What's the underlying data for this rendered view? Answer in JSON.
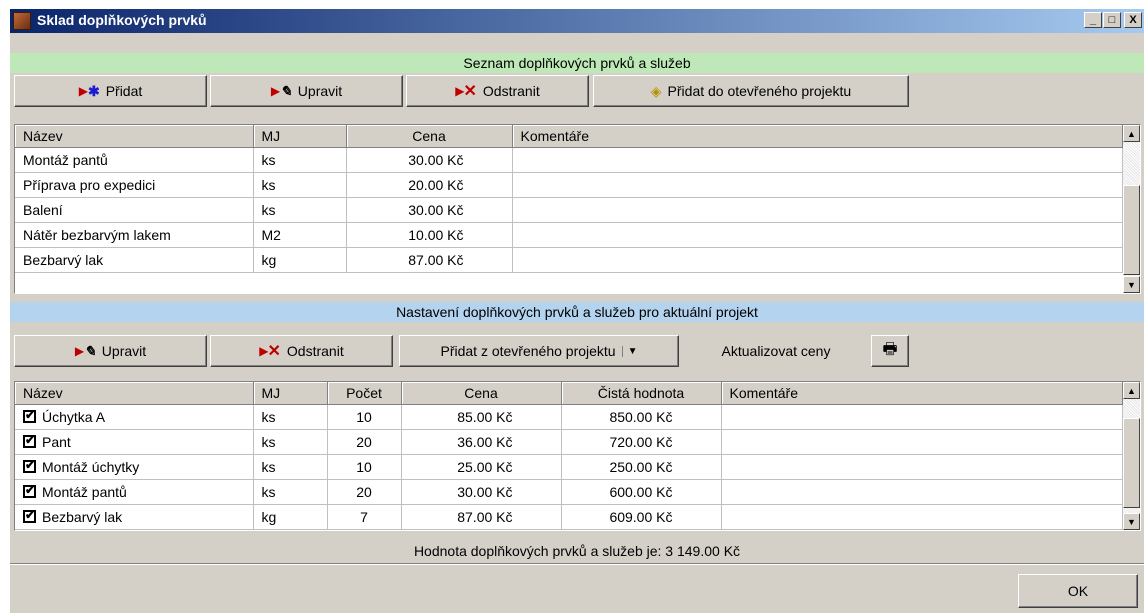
{
  "window": {
    "title": "Sklad doplňkových prvků",
    "minimize": "_",
    "maximize": "□",
    "close": "X"
  },
  "top": {
    "header": "Seznam doplňkových prvků a služeb",
    "buttons": {
      "add": "Přidat",
      "edit": "Upravit",
      "remove": "Odstranit",
      "add_to_project": "Přidat do otevřeného projektu"
    },
    "columns": [
      "Název",
      "MJ",
      "Cena",
      "Komentáře"
    ],
    "rows": [
      {
        "name": "Montáž pantů",
        "unit": "ks",
        "price": "30.00 Kč",
        "comment": ""
      },
      {
        "name": "Příprava pro expedici",
        "unit": "ks",
        "price": "20.00 Kč",
        "comment": ""
      },
      {
        "name": "Balení",
        "unit": "ks",
        "price": "30.00 Kč",
        "comment": ""
      },
      {
        "name": "Nátěr bezbarvým lakem",
        "unit": "M2",
        "price": "10.00 Kč",
        "comment": ""
      },
      {
        "name": "Bezbarvý lak",
        "unit": "kg",
        "price": "87.00 Kč",
        "comment": ""
      }
    ]
  },
  "bottom": {
    "header": "Nastavení doplňkových prvků a služeb pro aktuální projekt",
    "buttons": {
      "edit": "Upravit",
      "remove": "Odstranit",
      "add_from_project": "Přidat z otevřeného projektu",
      "update_prices": "Aktualizovat ceny"
    },
    "columns": [
      "Název",
      "MJ",
      "Počet",
      "Cena",
      "Čistá hodnota",
      "Komentáře"
    ],
    "rows": [
      {
        "name": "Úchytka A",
        "unit": "ks",
        "count": "10",
        "price": "85.00 Kč",
        "net": "850.00 Kč",
        "comment": ""
      },
      {
        "name": "Pant",
        "unit": "ks",
        "count": "20",
        "price": "36.00 Kč",
        "net": "720.00 Kč",
        "comment": ""
      },
      {
        "name": "Montáž úchytky",
        "unit": "ks",
        "count": "10",
        "price": "25.00 Kč",
        "net": "250.00 Kč",
        "comment": ""
      },
      {
        "name": "Montáž pantů",
        "unit": "ks",
        "count": "20",
        "price": "30.00 Kč",
        "net": "600.00 Kč",
        "comment": ""
      },
      {
        "name": "Bezbarvý lak",
        "unit": "kg",
        "count": "7",
        "price": "87.00 Kč",
        "net": "609.00 Kč",
        "comment": ""
      }
    ]
  },
  "summary": "Hodnota doplňkových prvků a služeb je: 3 149.00 Kč",
  "ok": "OK"
}
